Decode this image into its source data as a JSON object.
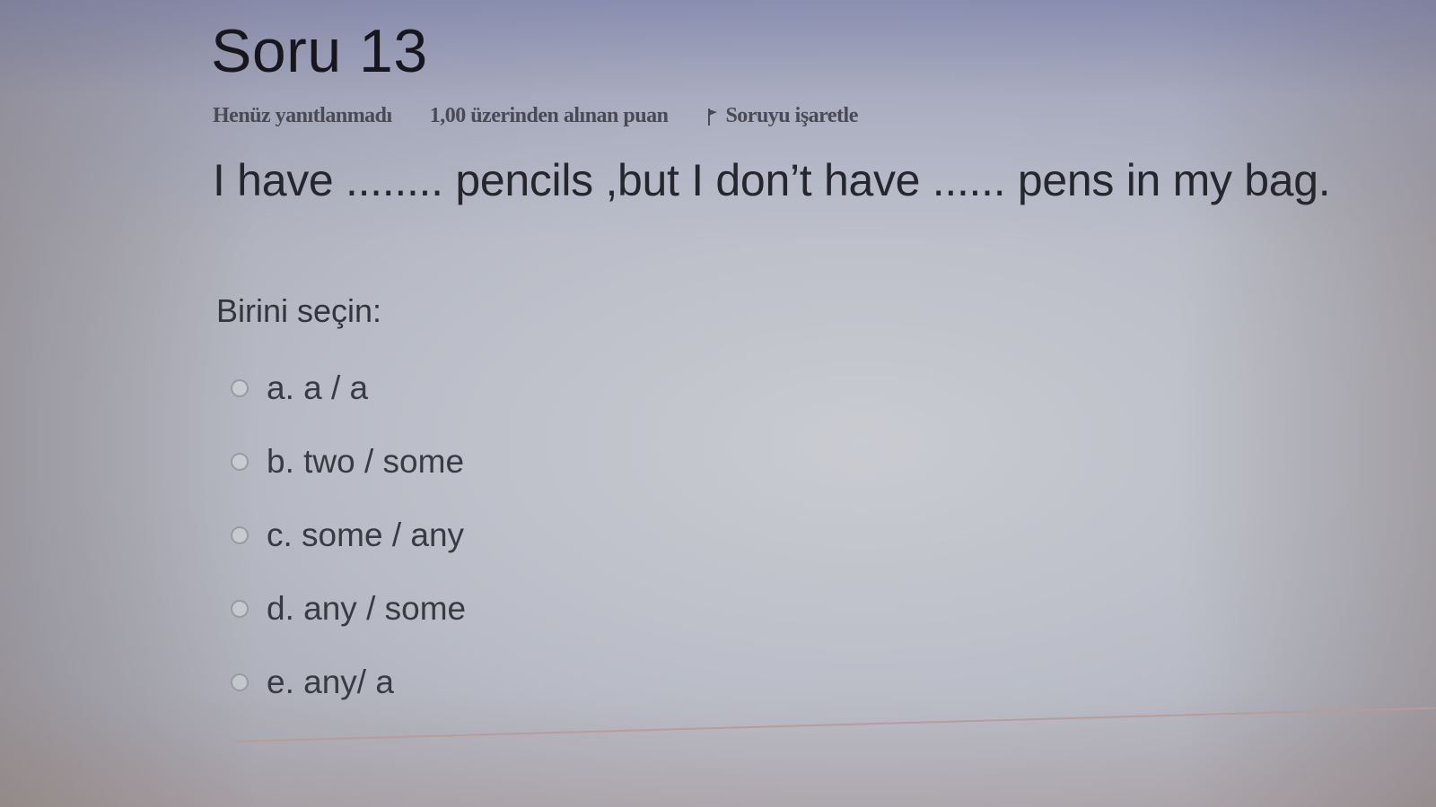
{
  "question": {
    "title": "Soru 13",
    "status": "Henüz yanıtlanmadı",
    "points": "1,00 üzerinden alınan puan",
    "flag_label": "Soruyu işaretle",
    "text": "I have ........ pencils ,but I don’t have ...... pens in my bag.",
    "prompt": "Birini seçin:"
  },
  "options": [
    {
      "label": "a. a / a"
    },
    {
      "label": "b. two / some"
    },
    {
      "label": "c. some / any"
    },
    {
      "label": "d. any / some"
    },
    {
      "label": "e. any/ a"
    }
  ]
}
